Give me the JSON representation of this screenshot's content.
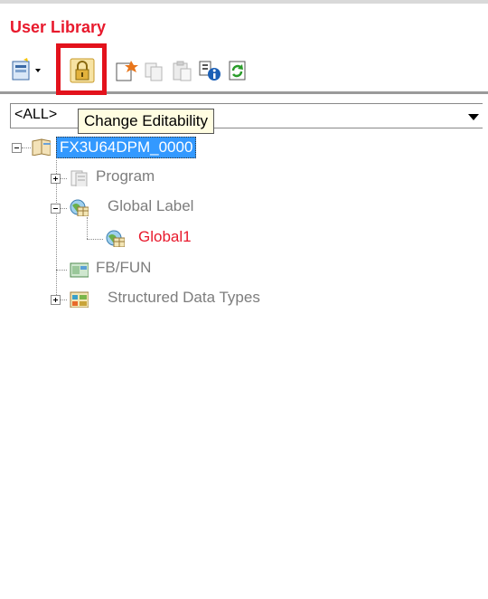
{
  "panel": {
    "title": "User Library"
  },
  "toolbar": {
    "buttons": [
      {
        "name": "new-item-dropdown",
        "icon": "new-item-icon"
      },
      {
        "name": "change-editability",
        "icon": "lock-icon"
      },
      {
        "name": "new-data",
        "icon": "new-data-icon"
      },
      {
        "name": "copy",
        "icon": "copy-icon"
      },
      {
        "name": "paste",
        "icon": "paste-icon"
      },
      {
        "name": "properties",
        "icon": "properties-icon"
      },
      {
        "name": "refresh",
        "icon": "refresh-icon"
      }
    ]
  },
  "filter": {
    "value": "<ALL>"
  },
  "tooltip": {
    "text": "Change Editability"
  },
  "tree": {
    "root": "FX3U64DPM_0000",
    "program": "Program",
    "global_label": "Global Label",
    "global1": "Global1",
    "fb_fun": "FB/FUN",
    "structured": "Structured Data Types"
  },
  "colors": {
    "title": "#e8192c",
    "highlight": "#e3121c",
    "selection": "#3399ff",
    "disabled_text": "#7d7d7d"
  }
}
